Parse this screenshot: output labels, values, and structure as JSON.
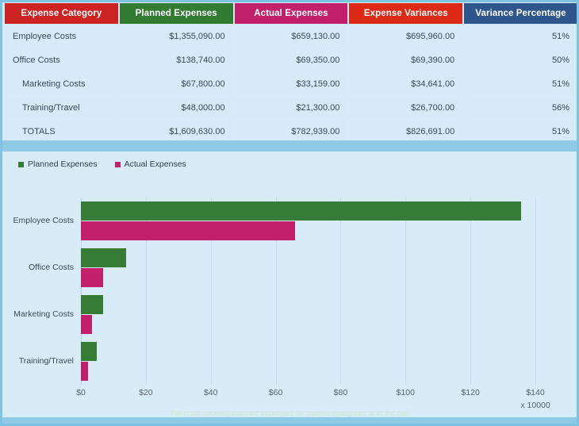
{
  "table": {
    "columns": [
      {
        "label": "Expense Category",
        "color": "#cc2222"
      },
      {
        "label": "Planned Expenses",
        "color": "#327b32"
      },
      {
        "label": "Actual Expenses",
        "color": "#c2206b"
      },
      {
        "label": "Expense Variances",
        "color": "#dd2a16"
      },
      {
        "label": "Variance Percentage",
        "color": "#2e558c"
      }
    ],
    "rows": [
      {
        "category": "Employee Costs",
        "planned": "$1,355,090.00",
        "actual": "$659,130.00",
        "variance": "$695,960.00",
        "percentage": "51%"
      },
      {
        "category": "Office Costs",
        "planned": "$138,740.00",
        "actual": "$69,350.00",
        "variance": "$69,390.00",
        "percentage": "50%"
      },
      {
        "category": "Marketing Costs",
        "planned": "$67,800.00",
        "actual": "$33,159.00",
        "variance": "$34,641.00",
        "percentage": "51%"
      },
      {
        "category": "Training/Travel",
        "planned": "$48,000.00",
        "actual": "$21,300.00",
        "variance": "$26,700.00",
        "percentage": "56%"
      },
      {
        "category": "TOTALS",
        "planned": "$1,609,630.00",
        "actual": "$782,939.00",
        "variance": "$826,691.00",
        "percentage": "51%"
      }
    ]
  },
  "chart_data": {
    "type": "bar",
    "orientation": "horizontal",
    "title": "",
    "xlabel": "",
    "ylabel": "",
    "categories": [
      "Employee Costs",
      "Office Costs",
      "Marketing Costs",
      "Training/Travel"
    ],
    "series": [
      {
        "name": "Planned Expenses",
        "color": "#367c36",
        "values": [
          1355090,
          138740,
          67800,
          48000
        ]
      },
      {
        "name": "Actual Expenses",
        "color": "#c2206b",
        "values": [
          659130,
          69350,
          33159,
          21300
        ]
      }
    ],
    "x_tick_labels": [
      "$0",
      "$20",
      "$40",
      "$60",
      "$80",
      "$100",
      "$120",
      "$140"
    ],
    "x_tick_values": [
      0,
      20,
      40,
      60,
      80,
      100,
      120,
      140
    ],
    "x_multiplier_label": "x 10000",
    "x_multiplier": 10000,
    "xlim": [
      0,
      140
    ],
    "grid": true,
    "legend_position": "top-left",
    "caption": "Pie chart showing planned expenses on various categories is in the cell"
  }
}
